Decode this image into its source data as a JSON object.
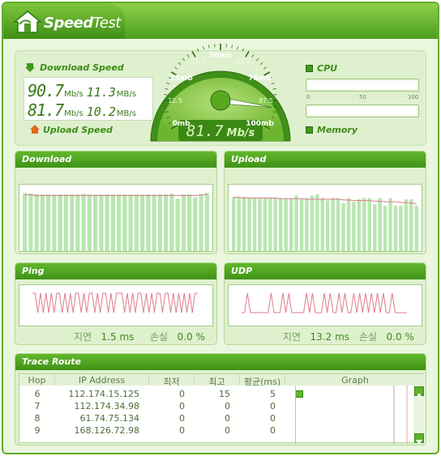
{
  "app": {
    "title_bold": "Speed",
    "title_light": "Test"
  },
  "meter": {
    "download_label": "Download Speed",
    "upload_label": "Upload Speed",
    "download": {
      "mbps": "90.7",
      "mbps_unit": "Mb/s",
      "MBps": "11.3",
      "MBps_unit": "MB/s"
    },
    "upload": {
      "mbps": "81.7",
      "mbps_unit": "Mb/s",
      "MBps": "10.2",
      "MBps_unit": "MB/s"
    },
    "gauge": {
      "ticks": [
        {
          "label": "0mb",
          "value": 0
        },
        {
          "label": "12.5",
          "value": 12.5
        },
        {
          "label": "25mb",
          "value": 25
        },
        {
          "label": "37.5",
          "value": 37.5
        },
        {
          "label": "50mb",
          "value": 50
        },
        {
          "label": "62.5",
          "value": 62.5
        },
        {
          "label": "75mb",
          "value": 75
        },
        {
          "label": "87.5",
          "value": 87.5
        },
        {
          "label": "100mb",
          "value": 100
        }
      ],
      "needle_value": 90.7,
      "readout": "81.7",
      "readout_unit": "Mb/s"
    },
    "cpu_label": "CPU",
    "memory_label": "Memory",
    "scale": [
      "0",
      "50",
      "100"
    ],
    "cpu_level": 0,
    "memory_level": 0
  },
  "download": {
    "title": "Download",
    "bars": [
      92,
      91,
      90,
      90,
      90,
      90,
      90,
      90,
      90,
      90,
      91,
      90,
      90,
      90,
      90,
      90,
      90,
      90,
      90,
      90,
      90,
      90,
      90,
      90,
      90,
      91,
      83,
      90,
      90,
      85,
      90,
      92
    ],
    "line": [
      89,
      89,
      88,
      88,
      88,
      88,
      88,
      88,
      88,
      88,
      88,
      88,
      88,
      88,
      88,
      88,
      88,
      88,
      88,
      88,
      88,
      88,
      88,
      88,
      88,
      88,
      88,
      88,
      88,
      88,
      89,
      90
    ]
  },
  "upload": {
    "title": "Upload",
    "bars": [
      86,
      86,
      86,
      84,
      84,
      84,
      84,
      84,
      84,
      84,
      84,
      84,
      88,
      82,
      84,
      88,
      90,
      84,
      80,
      84,
      84,
      76,
      84,
      78,
      82,
      84,
      84,
      74,
      84,
      72,
      84,
      72,
      72,
      82,
      82,
      72
    ],
    "line": [
      85,
      85,
      84,
      84,
      84,
      84,
      84,
      84,
      84,
      83,
      83,
      83,
      83,
      83,
      82,
      82,
      82,
      82,
      82,
      82,
      82,
      81,
      81,
      80,
      80,
      80,
      80,
      79,
      79,
      78,
      78,
      78,
      77,
      77,
      76,
      75
    ]
  },
  "ping": {
    "title": "Ping",
    "delay_label": "지연",
    "delay_value": "1.5 ms",
    "loss_label": "손실",
    "loss_value": "0.0 %",
    "samples": [
      1,
      1,
      0,
      1,
      0,
      1,
      0,
      1,
      0,
      1,
      1,
      0,
      1,
      0,
      1,
      0,
      1,
      1,
      0,
      1,
      0,
      1,
      1,
      0,
      1,
      0,
      1,
      1,
      0,
      1,
      0,
      1,
      1,
      1,
      0,
      1,
      0,
      1,
      0,
      1,
      1,
      0,
      1,
      0,
      1,
      0,
      1,
      1,
      0,
      1,
      1,
      0,
      1,
      0,
      1,
      0,
      1,
      0,
      1,
      0,
      1,
      1
    ]
  },
  "udp": {
    "title": "UDP",
    "delay_label": "지연",
    "delay_value": "13.2 ms",
    "loss_label": "손실",
    "loss_value": "0.0 %",
    "samples": [
      0,
      0,
      1,
      0,
      0,
      0,
      0,
      0,
      0,
      0,
      1,
      0,
      0,
      0,
      1,
      0,
      1,
      0,
      0,
      0,
      0,
      0,
      1,
      0,
      1,
      0,
      0,
      0,
      1,
      0,
      1,
      0,
      0,
      1,
      0,
      1,
      0,
      0,
      1,
      0,
      1,
      0,
      1,
      0,
      1,
      0,
      1,
      0,
      1,
      0,
      0,
      1,
      0,
      0,
      0,
      0,
      0
    ]
  },
  "trace": {
    "title": "Trace Route",
    "headers": [
      "Hop",
      "IP Address",
      "최저",
      "최고",
      "평균(ms)",
      "Graph"
    ],
    "rows": [
      {
        "hop": "6",
        "ip": "112.174.15.125",
        "min": "0",
        "max": "15",
        "avg": "5",
        "graph": 0.33
      },
      {
        "hop": "7",
        "ip": "112.174.34.98",
        "min": "0",
        "max": "0",
        "avg": "0",
        "graph": 0
      },
      {
        "hop": "8",
        "ip": "61.74.75.134",
        "min": "0",
        "max": "0",
        "avg": "0",
        "graph": 0
      },
      {
        "hop": "9",
        "ip": "168.126.72.98",
        "min": "0",
        "max": "0",
        "avg": "0",
        "graph": 0
      }
    ]
  },
  "colors": {
    "accent": "#4d9e1f",
    "bar": "#b9e6b2",
    "line": "#e07a8a",
    "digit": "#3a7a18"
  }
}
